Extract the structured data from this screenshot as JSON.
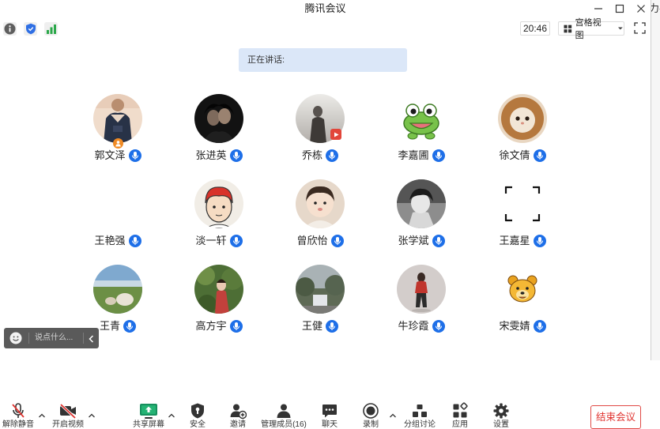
{
  "window": {
    "title": "腾讯会议",
    "side_text": "力手"
  },
  "status_bar": {
    "icons": [
      "info-icon",
      "shield-icon",
      "signal-icon"
    ],
    "time": "20:46",
    "view_mode": "宫格视图"
  },
  "speaking": {
    "label": "正在讲话:"
  },
  "participants": [
    {
      "name": "郭文泽",
      "mic_icon": "mic-on-icon"
    },
    {
      "name": "张进英",
      "mic_icon": "mic-on-icon"
    },
    {
      "name": "乔栋",
      "mic_icon": "mic-on-icon"
    },
    {
      "name": "李嘉圃",
      "mic_icon": "mic-on-icon"
    },
    {
      "name": "徐文倩",
      "mic_icon": "mic-on-icon"
    },
    {
      "name": "王艳强",
      "mic_icon": "mic-on-icon"
    },
    {
      "name": "淡一轩",
      "mic_icon": "mic-on-icon"
    },
    {
      "name": "曾欣怡",
      "mic_icon": "mic-on-icon"
    },
    {
      "name": "张学斌",
      "mic_icon": "mic-on-icon"
    },
    {
      "name": "王嘉星",
      "mic_icon": "mic-on-icon"
    },
    {
      "name": "王青",
      "mic_icon": "mic-on-icon"
    },
    {
      "name": "高方宇",
      "mic_icon": "mic-on-icon"
    },
    {
      "name": "王健",
      "mic_icon": "mic-on-icon"
    },
    {
      "name": "牛珍霞",
      "mic_icon": "mic-on-icon"
    },
    {
      "name": "宋雯婧",
      "mic_icon": "mic-on-icon"
    }
  ],
  "chat_box": {
    "placeholder": "说点什么..."
  },
  "toolbar": {
    "unmute": "解除静音",
    "start_video": "开启视频",
    "share_screen": "共享屏幕",
    "security": "安全",
    "invite": "邀请",
    "manage_members": "管理成员(16)",
    "chat": "聊天",
    "record": "录制",
    "breakout": "分组讨论",
    "apps": "应用",
    "settings": "设置",
    "end_meeting": "结束会议"
  },
  "colors": {
    "accent": "#1e6fe8",
    "danger": "#e0332f",
    "share_green": "#17905e",
    "speaking_bg": "#dbe7f8",
    "host_badge": "#f08a24"
  }
}
